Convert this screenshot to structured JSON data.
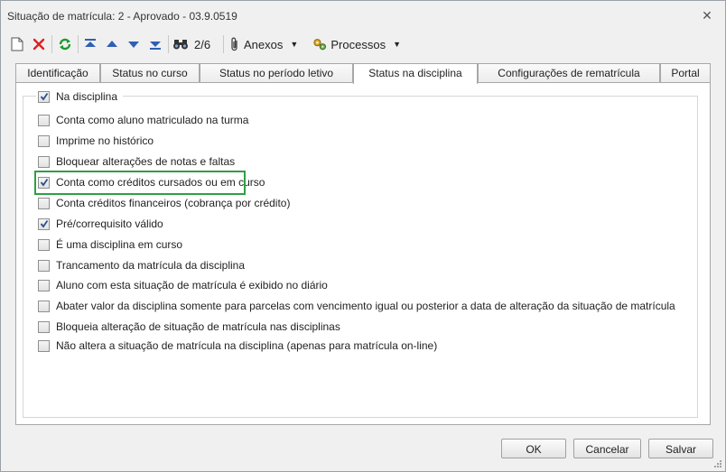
{
  "window": {
    "title": "Situação de matrícula: 2 - Aprovado - 03.9.0519",
    "close_glyph": "✕"
  },
  "toolbar": {
    "record_position": "2/6",
    "anexos_label": "Anexos",
    "processos_label": "Processos",
    "caret": "▼",
    "icons": [
      "new-document-icon",
      "delete-icon",
      "refresh-icon",
      "first-record-icon",
      "previous-record-icon",
      "next-record-icon",
      "last-record-icon",
      "binoculars-icon",
      "paperclip-icon",
      "gears-icon"
    ]
  },
  "tabs": [
    {
      "label": "Identificação",
      "active": false
    },
    {
      "label": "Status no curso",
      "active": false
    },
    {
      "label": "Status no período letivo",
      "active": false
    },
    {
      "label": "Status na disciplina",
      "active": true
    },
    {
      "label": "Configurações de rematrícula",
      "active": false
    },
    {
      "label": "Portal",
      "active": false
    }
  ],
  "group": {
    "label": "Na disciplina",
    "checked": true
  },
  "options": [
    {
      "label": "Conta como aluno matriculado na turma",
      "checked": false
    },
    {
      "label": "Imprime no histórico",
      "checked": false
    },
    {
      "label": "Bloquear alterações de notas e faltas",
      "checked": false
    },
    {
      "label": "Conta como créditos cursados ou em curso",
      "checked": true
    },
    {
      "label": "Conta créditos financeiros (cobrança por crédito)",
      "checked": false
    },
    {
      "label": "Pré/correquisito válido",
      "checked": true
    },
    {
      "label": "É uma disciplina em curso",
      "checked": false
    },
    {
      "label": "Trancamento da matrícula da disciplina",
      "checked": false
    },
    {
      "label": "Aluno com esta situação de matrícula é exibido no diário",
      "checked": false
    },
    {
      "label": "Abater valor da disciplina somente para parcelas com vencimento igual ou posterior a data de alteração da situação de matrícula",
      "checked": false
    },
    {
      "label": "Bloqueia alteração de situação de matrícula nas disciplinas",
      "checked": false
    },
    {
      "label": "Não altera a situação de matrícula na disciplina (apenas para matrícula on-line)",
      "checked": false
    }
  ],
  "buttons": {
    "ok": "OK",
    "cancel": "Cancelar",
    "save": "Salvar"
  },
  "colors": {
    "highlight": "#2ea043",
    "check": "#2b4e8c"
  }
}
